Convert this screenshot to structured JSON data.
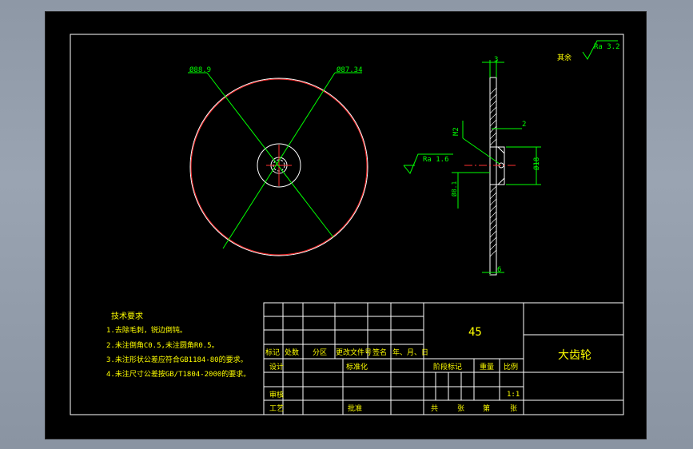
{
  "drawing": {
    "dims": {
      "d_outer": "Ø88.9",
      "d_pitch": "Ø87.34",
      "thk_top": "3",
      "step": "2",
      "thread": "M2",
      "width_bottom": "6",
      "bore": "Ø18",
      "hole_label": "Ø8.1"
    },
    "roughness": {
      "general_prefix": "其余",
      "general": "Ra 3.2",
      "bore": "Ra 1.6"
    },
    "tech_req": {
      "title": "技术要求",
      "lines": [
        "1.去除毛刺，锐边倒钝。",
        "2.未注倒角C0.5,未注圆角R0.5。",
        "3.未注形状公差应符合GB1184-80的要求。",
        "4.未注尺寸公差按GB/T1804-2000的要求。"
      ]
    },
    "title_block": {
      "material": "45",
      "part_name": "大齿轮",
      "headers": [
        "标记",
        "处数",
        "分区",
        "更改文件号",
        "签名",
        "年、月、日"
      ],
      "design": "设计",
      "standardize": "标准化",
      "review": "审核",
      "process": "工艺",
      "approve": "批准",
      "stage_mark": "阶段标记",
      "weight": "重量",
      "scale_label": "比例",
      "scale": "1:1",
      "total": "共",
      "sheet_unit": "张",
      "sheet_no": "第",
      "sheet_unit2": "张"
    },
    "colors": {
      "line": "#ffffff",
      "dim": "#00ff00",
      "center": "#ff0000",
      "text": "#ffff00",
      "background": "#000000"
    }
  }
}
